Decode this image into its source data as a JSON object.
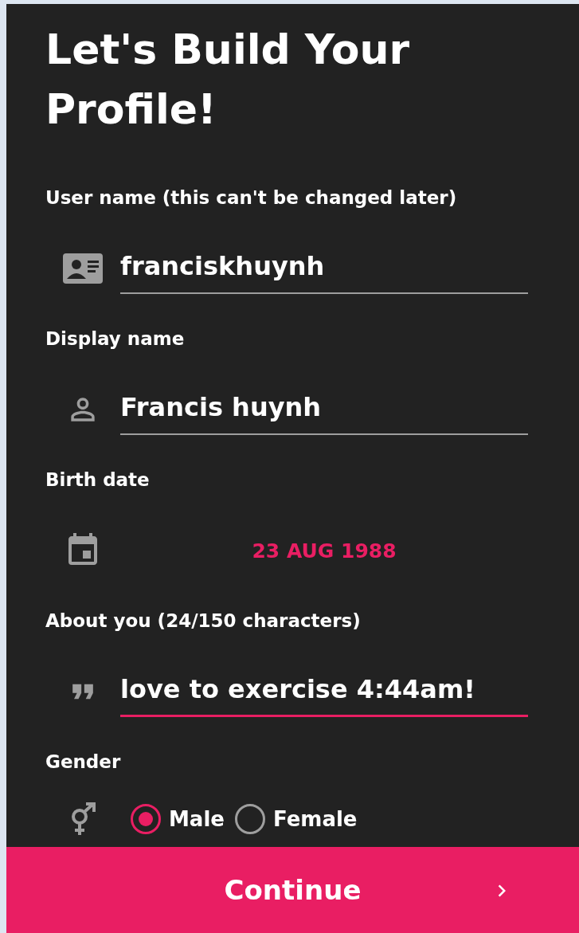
{
  "title": "Let's Build Your Profile!",
  "fields": [
    {
      "kind": "username",
      "label": "User name (this can't be changed later)",
      "value": "franciskhuynh",
      "focused": false
    },
    {
      "kind": "name",
      "label": "Display name",
      "value": "Francis huynh",
      "focused": false
    },
    {
      "kind": "date",
      "label": "Birth date",
      "value": "23 AUG 1988"
    },
    {
      "kind": "about",
      "label": "About you (24/150 characters)",
      "value": "love to exercise 4:44am!",
      "focused": true
    }
  ],
  "gender": {
    "label": "Gender",
    "options": [
      {
        "label": "Male",
        "selected": true
      },
      {
        "label": "Female",
        "selected": false
      }
    ]
  },
  "continue_button": {
    "label": "Continue"
  }
}
